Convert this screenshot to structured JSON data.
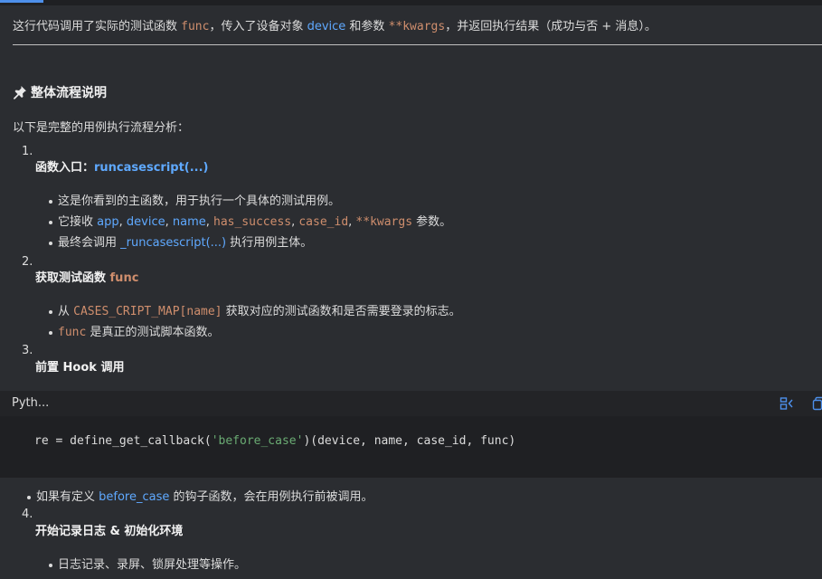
{
  "intro": {
    "p1": "这行代码调用了实际的测试函数 ",
    "c1": "func",
    "p2": "，传入了设备对象 ",
    "l1": "device",
    "p3": " 和参数 ",
    "c2": "**kwargs",
    "p4": "，并返回执行结果（成功与否 + 消息）。"
  },
  "heading": "整体流程说明",
  "lead": "以下是完整的用例执行流程分析：",
  "steps": [
    {
      "num": "1.",
      "title": "函数入口：",
      "title_link": "runcasescript(...)",
      "bullets": [
        {
          "text": "这是你看到的主函数，用于执行一个具体的测试用例。"
        },
        {
          "pre": "它接收 ",
          "items": [
            "app",
            ", ",
            "device",
            ", ",
            "name",
            ", ",
            "has_success",
            ", ",
            "case_id",
            ", ",
            "**kwargs"
          ],
          "post": " 参数。"
        },
        {
          "pre": "最终会调用 ",
          "link": "_runcasescript(...)",
          "post": " 执行用例主体。"
        }
      ]
    },
    {
      "num": "2.",
      "title": "获取测试函数 ",
      "title_code": "func",
      "bullets": [
        {
          "pre": "从 ",
          "code": "CASES_CRIPT_MAP[name]",
          "post": " 获取对应的测试函数和是否需要登录的标志。"
        },
        {
          "code": "func",
          "post": " 是真正的测试脚本函数。"
        }
      ]
    },
    {
      "num": "3.",
      "title": "前置 Hook 调用"
    },
    {
      "num": "4.",
      "title": "开始记录日志 & 初始化环境",
      "bullets": [
        {
          "text": "日志记录、录屏、锁屏处理等操作。"
        }
      ]
    }
  ],
  "codeblock": {
    "lang": "Pyth...",
    "code_a": "re ",
    "code_eq": "=",
    "code_b": " define_get_callback(",
    "code_str": "'before_case'",
    "code_c": ")(device, name, case_id, func)"
  },
  "after_code": {
    "pre": "如果有定义 ",
    "link": "before_case",
    "post": " 的钩子函数，会在用例执行前被调用。"
  },
  "colors": {
    "background": "#2b2d31",
    "link": "#5fa9ff",
    "code": "#cf8e6d",
    "string": "#6aab73",
    "icon": "#4d8fea"
  }
}
